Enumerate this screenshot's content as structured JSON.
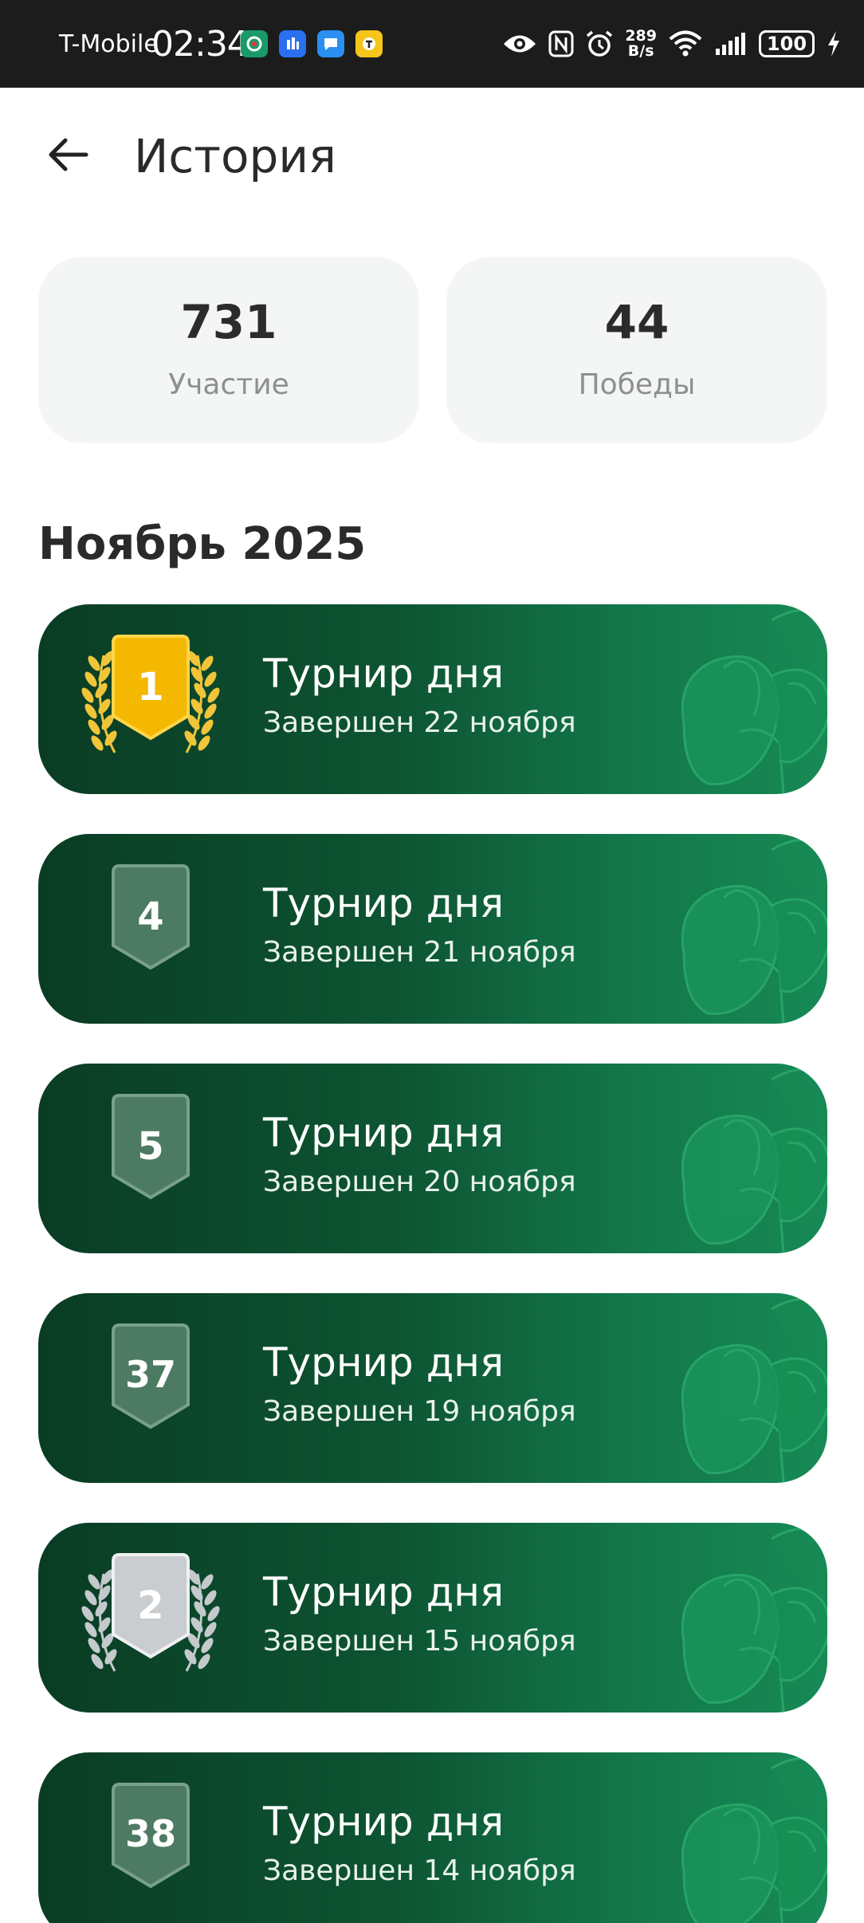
{
  "status_bar": {
    "carrier": "T-Mobile",
    "time": "02:34",
    "net_speed_value": "289",
    "net_speed_unit": "B/s",
    "battery": "100",
    "notification_icons": [
      "green-app-icon",
      "blue-app-icon",
      "chat-app-icon",
      "yellow-app-icon"
    ],
    "system_icons": [
      "eye-icon",
      "nfc-icon",
      "alarm-icon",
      "wifi-icon",
      "signal-icon",
      "battery-icon",
      "charging-icon"
    ]
  },
  "header": {
    "title": "История",
    "back_icon": "arrow-left-icon"
  },
  "stats": {
    "participation": {
      "value": "731",
      "label": "Участие"
    },
    "wins": {
      "value": "44",
      "label": "Победы"
    }
  },
  "section": {
    "title": "Ноябрь 2025"
  },
  "tournaments": [
    {
      "rank": "1",
      "medal": "gold",
      "title": "Турнир дня",
      "subtitle": "Завершен 22 ноября"
    },
    {
      "rank": "4",
      "medal": "none",
      "title": "Турнир дня",
      "subtitle": "Завершен 21 ноября"
    },
    {
      "rank": "5",
      "medal": "none",
      "title": "Турнир дня",
      "subtitle": "Завершен 20 ноября"
    },
    {
      "rank": "37",
      "medal": "none",
      "title": "Турнир дня",
      "subtitle": "Завершен 19 ноября"
    },
    {
      "rank": "2",
      "medal": "silver",
      "title": "Турнир дня",
      "subtitle": "Завершен 15 ноября"
    },
    {
      "rank": "38",
      "medal": "none",
      "title": "Турнир дня",
      "subtitle": "Завершен 14 ноября"
    }
  ],
  "colors": {
    "status_bar_bg": "#1c1c1c",
    "card_dark": "#0a3c24",
    "card_light": "#178a55",
    "gold": "#f5b800",
    "silver": "#c9cdd0",
    "badge_plain": "#4d7a62",
    "stat_card_bg": "#f4f6f5"
  }
}
